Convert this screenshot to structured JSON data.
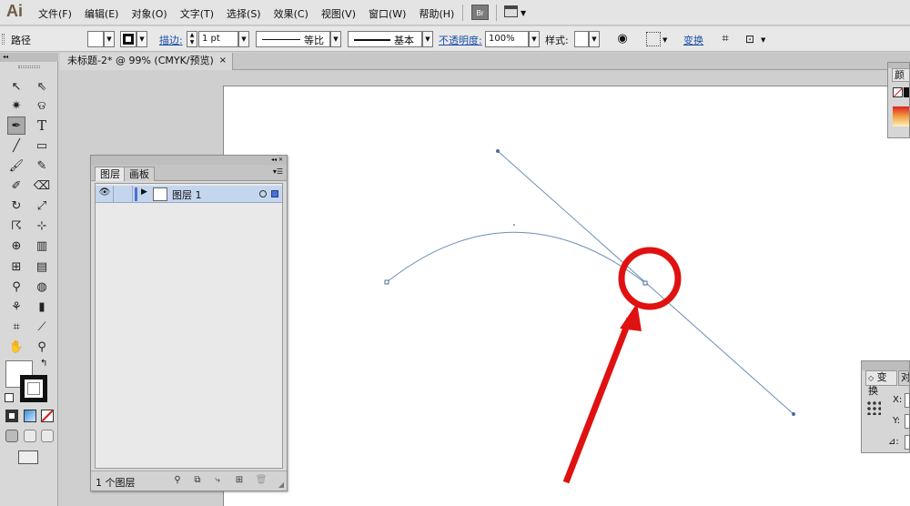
{
  "app": {
    "logo": "Ai"
  },
  "menu": {
    "items": [
      "文件(F)",
      "编辑(E)",
      "对象(O)",
      "文字(T)",
      "选择(S)",
      "效果(C)",
      "视图(V)",
      "窗口(W)",
      "帮助(H)"
    ],
    "bridge": "Br"
  },
  "control": {
    "object_type": "路径",
    "stroke_label": "描边:",
    "stroke_weight": "1 pt",
    "profile_label": "等比",
    "brush_label": "基本",
    "opacity_label": "不透明度:",
    "opacity_value": "100%",
    "style_label": "样式:",
    "transform_label": "变换"
  },
  "document": {
    "tab_title": "未标题-2* @ 99% (CMYK/预览)",
    "close": "×"
  },
  "layers_panel": {
    "tabs": [
      "图层",
      "画板"
    ],
    "layer_name": "图层 1",
    "count": "1 个图层"
  },
  "right_panels": {
    "color_tab": "颜",
    "transform_tab": "变换",
    "transform_tab2": "对",
    "x_label": "X:",
    "y_label": "Y:",
    "angle_label": "⊿:"
  },
  "colors": {
    "annotation_red": "#e01111",
    "path_blue": "#6b8fb5",
    "selection_blue": "#c4d5ee"
  },
  "icons": [
    "selection-tool-icon",
    "direct-selection-icon",
    "magic-wand-icon",
    "lasso-icon",
    "pen-tool-icon",
    "type-tool-icon",
    "line-tool-icon",
    "rectangle-tool-icon",
    "paintbrush-icon",
    "pencil-icon",
    "blob-brush-icon",
    "eraser-icon",
    "rotate-icon",
    "scale-icon",
    "warp-icon",
    "free-transform-icon",
    "shape-builder-icon",
    "perspective-grid-icon",
    "mesh-icon",
    "gradient-icon",
    "eyedropper-icon",
    "blend-icon",
    "symbol-sprayer-icon",
    "graph-icon",
    "artboard-icon",
    "slice-icon",
    "hand-icon",
    "zoom-icon"
  ]
}
